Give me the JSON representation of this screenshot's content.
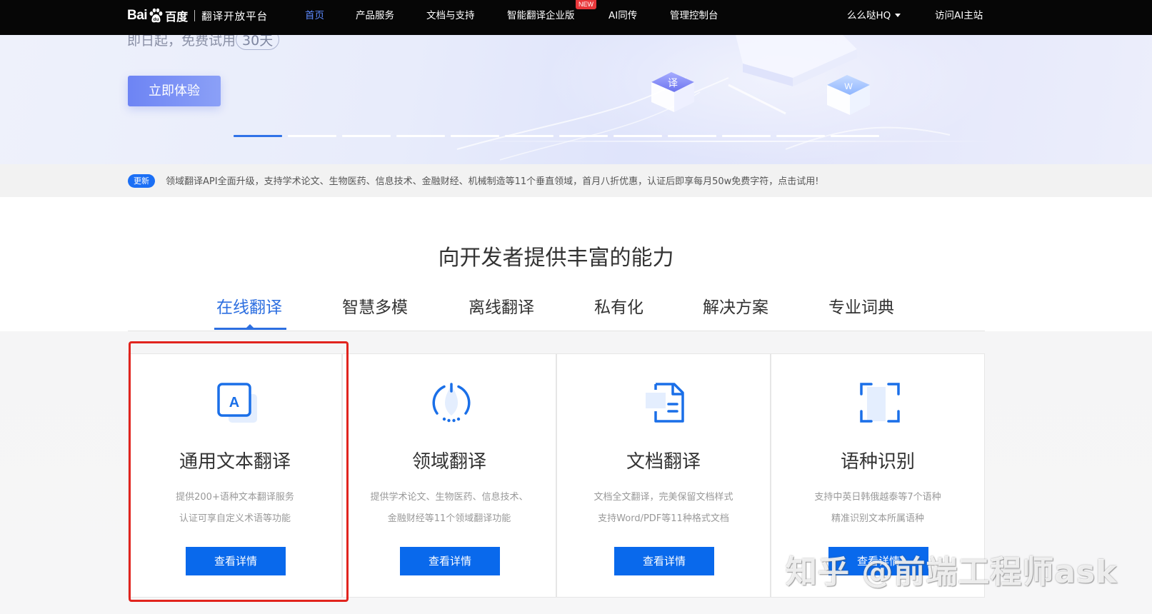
{
  "nav": {
    "logo_text": "Bai",
    "logo_cn": "百度",
    "platform": "翻译开放平台",
    "items": [
      "首页",
      "产品服务",
      "文档与支持",
      "智能翻译企业版",
      "AI同传",
      "管理控制台"
    ],
    "new_badge": "NEW",
    "user": "么么哒HQ",
    "visit": "访问AI主站"
  },
  "banner": {
    "subtitle_prefix": "即日起，免费试用",
    "subtitle_num": "30天",
    "try_button": "立即体验",
    "dot_count": 12,
    "active_dot": 0
  },
  "notice": {
    "badge": "更新",
    "text": "领域翻译API全面升级，支持学术论文、生物医药、信息技术、金融财经、机械制造等11个垂直领域，首月八折优惠，认证后即享每月50w免费字符，点击试用!"
  },
  "section": {
    "title": "向开发者提供丰富的能力",
    "tabs": [
      "在线翻译",
      "智慧多模",
      "离线翻译",
      "私有化",
      "解决方案",
      "专业词典"
    ],
    "active_tab": 0
  },
  "cards": [
    {
      "icon": "text-translate-icon",
      "title": "通用文本翻译",
      "desc1": "提供200+语种文本翻译服务",
      "desc2": "认证可享自定义术语等功能",
      "button": "查看详情"
    },
    {
      "icon": "domain-translate-icon",
      "title": "领域翻译",
      "desc1": "提供学术论文、生物医药、信息技术、",
      "desc2": "金融财经等11个领域翻译功能",
      "button": "查看详情"
    },
    {
      "icon": "document-translate-icon",
      "title": "文档翻译",
      "desc1": "文档全文翻译，完美保留文档样式",
      "desc2": "支持Word/PDF等11种格式文档",
      "button": "查看详情"
    },
    {
      "icon": "language-detect-icon",
      "title": "语种识别",
      "desc1": "支持中英日韩俄越泰等7个语种",
      "desc2": "精准识别文本所属语种",
      "button": "查看详情"
    }
  ],
  "watermark": "知乎 @前端工程师ask",
  "colors": {
    "nav_bg": "#060606",
    "nav_active": "#5d8aff",
    "primary": "#0969ec",
    "tab_active": "#2d6fe0",
    "highlight": "#e1241e"
  }
}
